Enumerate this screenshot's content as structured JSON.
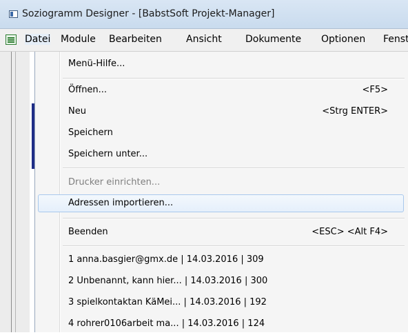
{
  "window": {
    "title": "Soziogramm Designer - [BabstSoft Projekt-Manager]"
  },
  "menubar": {
    "items": [
      {
        "label": "Datei"
      },
      {
        "label": "Module"
      },
      {
        "label": "Bearbeiten"
      },
      {
        "label": "Ansicht"
      },
      {
        "label": "Dokumente"
      },
      {
        "label": "Optionen"
      },
      {
        "label": "Fenste"
      }
    ]
  },
  "file_menu": {
    "items": [
      {
        "label": "Menü-Hilfe...",
        "shortcut": ""
      },
      {
        "label": "Öffnen...",
        "shortcut": "<F5>"
      },
      {
        "label": "Neu",
        "shortcut": "<Strg ENTER>"
      },
      {
        "label": "Speichern",
        "shortcut": ""
      },
      {
        "label": "Speichern unter...",
        "shortcut": ""
      },
      {
        "label": "Drucker einrichten...",
        "shortcut": "",
        "disabled": true
      },
      {
        "label": "Adressen importieren...",
        "shortcut": "",
        "highlighted": true
      },
      {
        "label": "Beenden",
        "shortcut": "<ESC> <Alt F4>"
      }
    ],
    "recent_files": [
      {
        "label": "1 anna.basgier@gmx.de | 14.03.2016 | 309"
      },
      {
        "label": "2 Unbenannt, kann hier... | 14.03.2016 | 300"
      },
      {
        "label": "3 spielkontaktan KäMei... | 14.03.2016 | 192"
      },
      {
        "label": "4 rohrer0106arbeit  ma... | 14.03.2016 | 124"
      }
    ]
  },
  "colors": {
    "highlight_border": "#a8c8ec",
    "highlight_fill": "#e5effb",
    "disabled_text": "#7f7f7f"
  },
  "icons": {
    "app": "application-icon",
    "menubar": "document-menu-icon"
  }
}
